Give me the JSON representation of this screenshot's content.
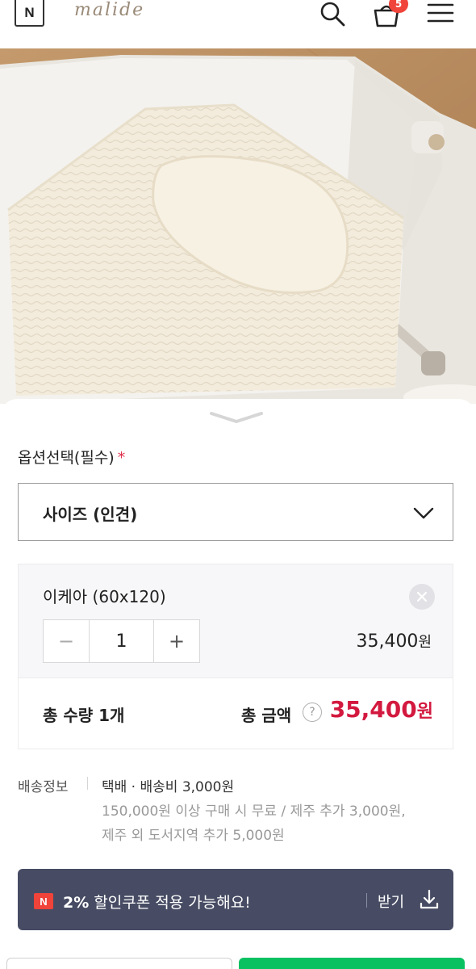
{
  "header": {
    "store_badge": "N",
    "brand": "malide",
    "cart_count": "5",
    "icons": [
      "search-icon",
      "cart-icon",
      "hamburger-menu-icon"
    ]
  },
  "option": {
    "label": "옵션선택(필수)",
    "required_mark": "*",
    "selected": "사이즈 (인견)"
  },
  "item": {
    "name": "이케아 (60x120)",
    "quantity": "1",
    "minus": "−",
    "plus": "+",
    "price_number": "35,400",
    "price_unit": "원"
  },
  "total": {
    "qty_text": "총 수량 1개",
    "amount_label": "총 금액",
    "help": "?",
    "price_number": "35,400",
    "price_unit": "원"
  },
  "shipping": {
    "label": "배송정보",
    "main": "택배 · 배송비 3,000원",
    "line2": "150,000원 이상 구매 시 무료 / 제주 추가 3,000원,",
    "line3": "제주 외 도서지역 추가 5,000원"
  },
  "coupon": {
    "badge": "N",
    "percent": "2%",
    "text": " 할인쿠폰 적용 가능해요!",
    "action": "받기"
  },
  "colors": {
    "price_accent": "#d3193f",
    "coupon_bg": "#474c64",
    "badge_red": "#f0433a",
    "buy_button": "#0ac162"
  }
}
